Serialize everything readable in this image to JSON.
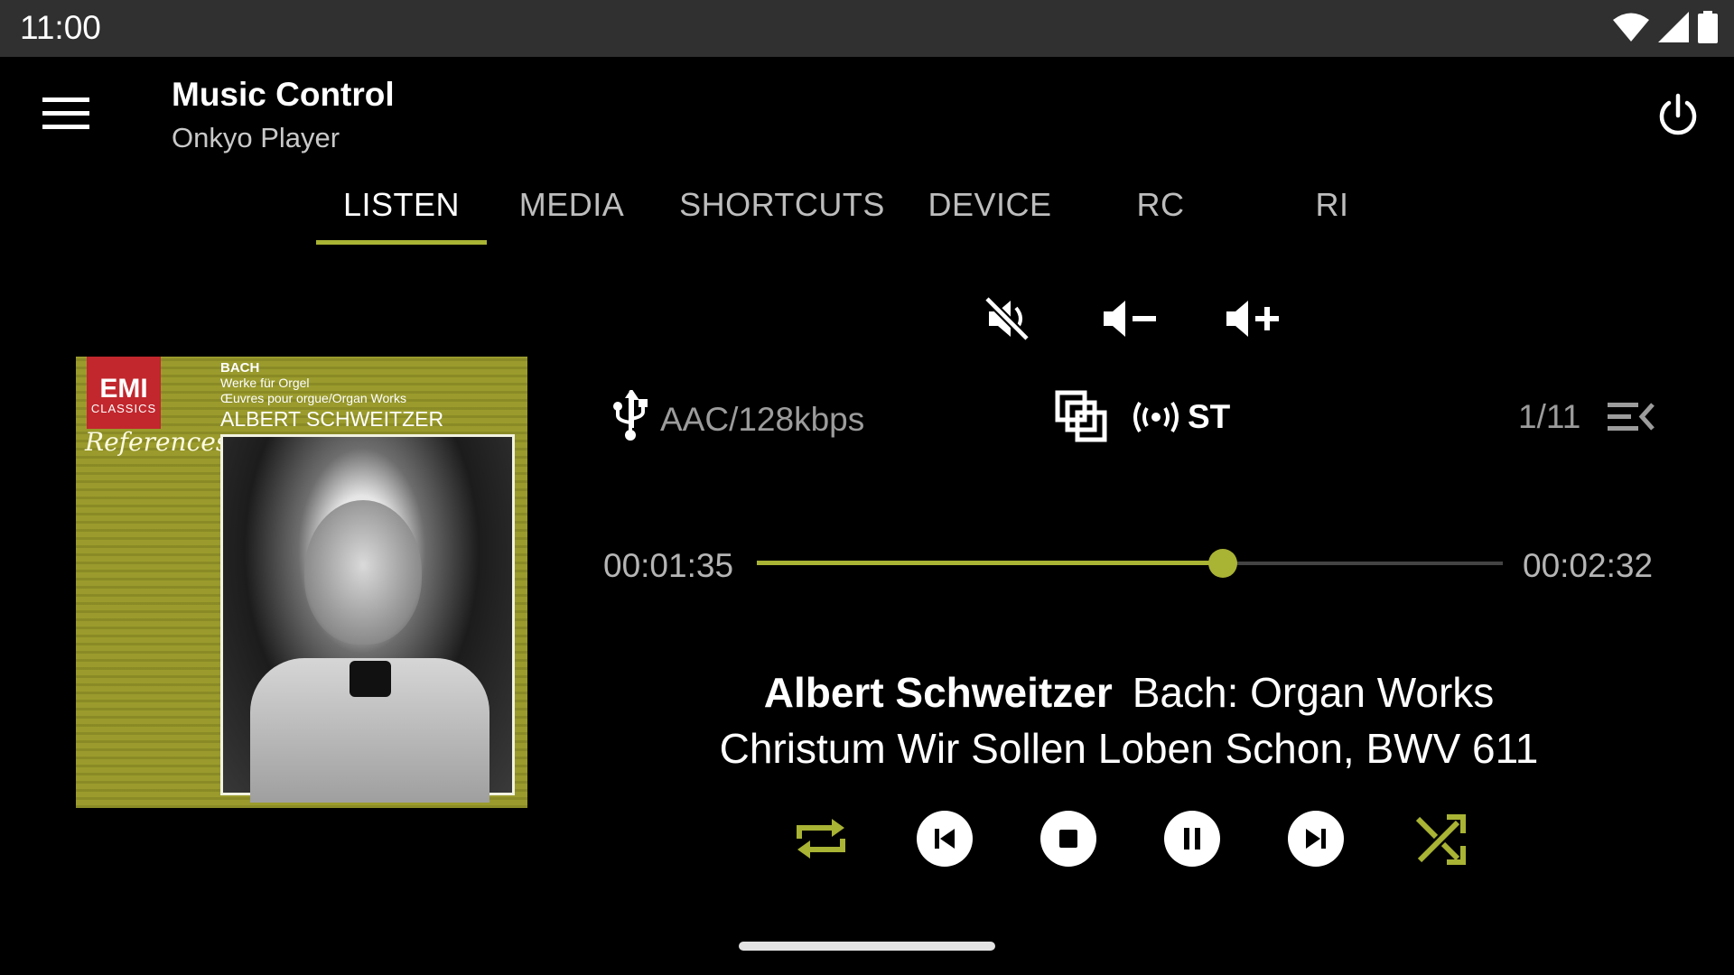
{
  "status_bar": {
    "time": "11:00",
    "icons": [
      "wifi-icon",
      "cell-signal-icon",
      "battery-icon"
    ]
  },
  "app_bar": {
    "title": "Music Control",
    "subtitle": "Onkyo Player",
    "menu_icon": "menu-icon",
    "power_icon": "power-icon"
  },
  "tabs": [
    {
      "label": "LISTEN",
      "active": true
    },
    {
      "label": "MEDIA",
      "active": false
    },
    {
      "label": "SHORTCUTS",
      "active": false
    },
    {
      "label": "DEVICE",
      "active": false
    },
    {
      "label": "RC",
      "active": false
    },
    {
      "label": "RI",
      "active": false
    }
  ],
  "volume_controls": [
    "mute-icon",
    "volume-down-icon",
    "volume-up-icon"
  ],
  "album_art": {
    "logo_main": "EMI",
    "logo_sub": "CLASSICS",
    "series": "References",
    "composer": "BACH",
    "line1": "Werke für Orgel",
    "line2": "Œuvres pour orgue/Organ Works",
    "artist": "ALBERT SCHWEITZER"
  },
  "info": {
    "source_icon": "usb-icon",
    "format": "AAC/128kbps",
    "dsp_icon": "dsp-mode-icon",
    "stereo": "ST",
    "track_count": "1/11",
    "queue_icon": "queue-icon"
  },
  "progress": {
    "elapsed": "00:01:35",
    "total": "00:02:32",
    "fraction": 0.625
  },
  "now_playing": {
    "artist": "Albert Schweitzer",
    "album": "Bach: Organ Works",
    "title": "Christum Wir Sollen Loben Schon, BWV 611"
  },
  "playback": [
    "repeat-icon",
    "previous-icon",
    "stop-icon",
    "pause-icon",
    "next-icon",
    "shuffle-icon"
  ],
  "colors": {
    "accent": "#a9b334",
    "background": "#000000",
    "status_bar": "#303030",
    "secondary_text": "#9c9c9c"
  }
}
